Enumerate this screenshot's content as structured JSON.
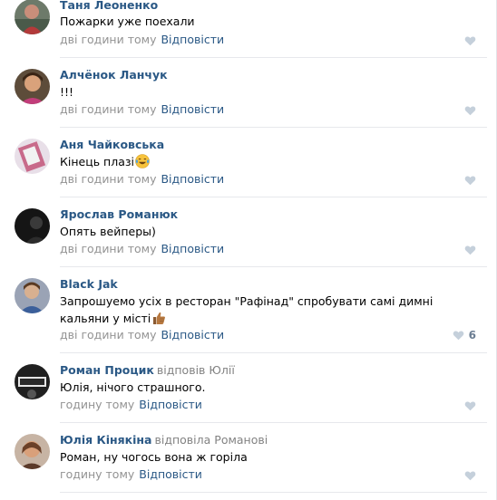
{
  "comments": [
    {
      "author": "Таня Леоненко",
      "reply_prefix": "",
      "reply_name": "",
      "text": "Пожарки уже поехали",
      "emoji": "",
      "time": "дві години тому",
      "reply_label": "Відповісти",
      "likes": "",
      "avatar_color": "#8a6a5a"
    },
    {
      "author": "Алчёнок Ланчук",
      "reply_prefix": "",
      "reply_name": "",
      "text": "!!!",
      "emoji": "",
      "time": "дві години тому",
      "reply_label": "Відповісти",
      "likes": "",
      "avatar_color": "#7a5a3a"
    },
    {
      "author": "Аня Чайковська",
      "reply_prefix": "",
      "reply_name": "",
      "text": "Кінець плазі",
      "emoji": "laughing-tears-emoji",
      "time": "дві години тому",
      "reply_label": "Відповісти",
      "likes": "",
      "avatar_color": "#c2a6c8"
    },
    {
      "author": "Ярослав Романюк",
      "reply_prefix": "",
      "reply_name": "",
      "text": "Опять вейперы)",
      "emoji": "",
      "time": "дві години тому",
      "reply_label": "Відповісти",
      "likes": "",
      "avatar_color": "#1e1e1e"
    },
    {
      "author": "Black Jak",
      "reply_prefix": "",
      "reply_name": "",
      "text": "Запрошуемо усіх в ресторан \"Рафінад\" спробувати самі димні кальяни у місті",
      "emoji": "thumbs-up-emoji",
      "time": "дві години тому",
      "reply_label": "Відповісти",
      "likes": "6",
      "avatar_color": "#8d96a8"
    },
    {
      "author": "Роман Процик",
      "reply_prefix": "відповів",
      "reply_name": "Юлії",
      "text": "Юлія, нічого страшного.",
      "emoji": "",
      "time": "годину тому",
      "reply_label": "Відповісти",
      "likes": "",
      "avatar_color": "#2b2b2b"
    },
    {
      "author": "Юлія Кінякіна",
      "reply_prefix": "відповіла",
      "reply_name": "Романові",
      "text": "Роман, ну чогось вона ж горіла",
      "emoji": "",
      "time": "годину тому",
      "reply_label": "Відповісти",
      "likes": "",
      "avatar_color": "#a07a5c"
    }
  ],
  "colors": {
    "author_link": "#2a5885",
    "meta_gray": "#939393",
    "like_heart": "#b4c1d1",
    "divider": "#e7e8ec"
  }
}
